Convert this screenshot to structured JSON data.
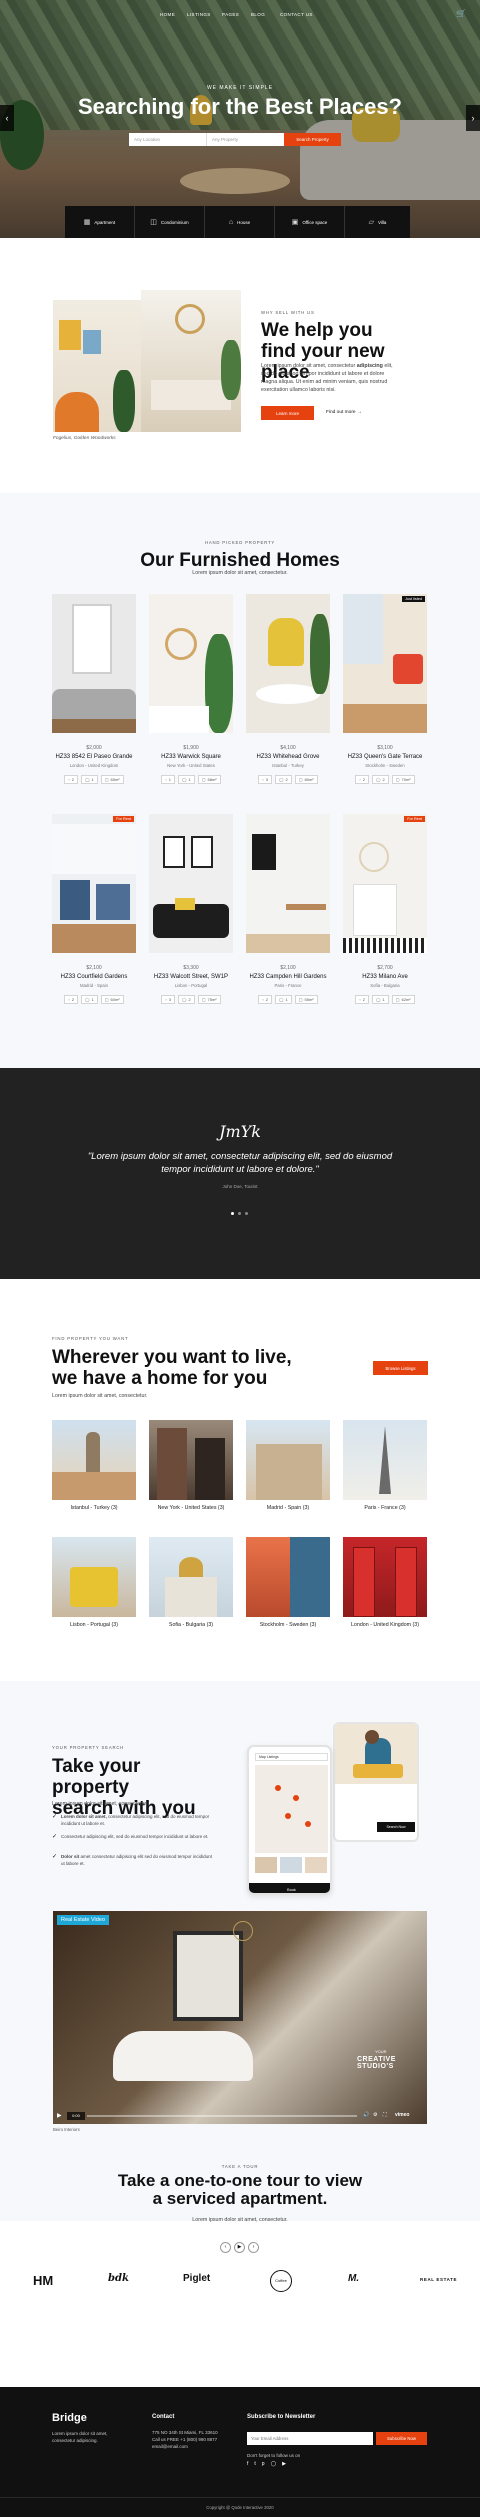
{
  "nav": {
    "items": [
      "HOME",
      "LISTINGS",
      "PAGES",
      "BLOG",
      "CONTACT US"
    ],
    "cart_icon": "cart-icon"
  },
  "hero": {
    "kicker": "WE MAKE IT SIMPLE",
    "title": "Searching for the Best Places?",
    "location_placeholder": "Any Location",
    "type_placeholder": "Any Property",
    "search_label": "Search Property",
    "categories": [
      {
        "label": "Apartment",
        "icon": "building-icon"
      },
      {
        "label": "Condominium",
        "icon": "condo-icon"
      },
      {
        "label": "House",
        "icon": "house-icon"
      },
      {
        "label": "Office space",
        "icon": "office-icon"
      },
      {
        "label": "Villa",
        "icon": "villa-icon"
      }
    ]
  },
  "help": {
    "kicker": "WHY SELL WITH US",
    "title": "We help you find your new place",
    "body_lead": "Lorem ipsum dolor sit amet, consectetur",
    "body_bold": "adipiscing",
    "body_rest": "elit, sed do eiusmod tempor incididunt ut labore et dolore magna aliqua. Ut enim ad minim veniam, quis nostrud exercitation ullamco laboris nisi.",
    "cta": "Learn more",
    "link": "Find out more",
    "caption": "Fogelius, Golden Woodworks"
  },
  "homes": {
    "kicker": "HAND PICKED PROPERTY",
    "title": "Our Furnished Homes",
    "subtitle": "Lorem ipsum dolor sit amet, consectetur.",
    "cards": [
      {
        "price": "$2,000",
        "title": "HZ33 8542 El Paseo Grande",
        "loc": "London - United Kingdom",
        "beds": "2",
        "baths": "1",
        "area": "65m²",
        "badge": ""
      },
      {
        "price": "$1,900",
        "title": "HZ33 Warwick Square",
        "loc": "New York - United States",
        "beds": "1",
        "baths": "1",
        "area": "58m²",
        "badge": ""
      },
      {
        "price": "$4,100",
        "title": "HZ33 Whitehead Grove",
        "loc": "Istanbul - Turkey",
        "beds": "3",
        "baths": "2",
        "area": "80m²",
        "badge": ""
      },
      {
        "price": "$3,100",
        "title": "HZ33 Queen's Gate Terrace",
        "loc": "Stockholm - Sweden",
        "beds": "2",
        "baths": "2",
        "area": "70m²",
        "badge": "Just listed"
      },
      {
        "price": "$2,100",
        "title": "HZ33 Courtfield Gardens",
        "loc": "Madrid - Spain",
        "beds": "2",
        "baths": "1",
        "area": "60m²",
        "badge": "For Rent"
      },
      {
        "price": "$3,300",
        "title": "HZ33 Walcott Street, SW1P",
        "loc": "Lisbon - Portugal",
        "beds": "3",
        "baths": "2",
        "area": "75m²",
        "badge": ""
      },
      {
        "price": "$2,100",
        "title": "HZ33 Campden Hill Gardens",
        "loc": "Paris - France",
        "beds": "2",
        "baths": "1",
        "area": "55m²",
        "badge": ""
      },
      {
        "price": "$2,700",
        "title": "HZ33 Milano Ave",
        "loc": "Sofia - Bulgaria",
        "beds": "2",
        "baths": "1",
        "area": "62m²",
        "badge": "For Rent"
      }
    ]
  },
  "testimonial": {
    "quote": "\"Lorem ipsum dolor sit amet, consectetur adipiscing elit, sed do eiusmod tempor incididunt ut labore et dolore.\"",
    "author": "John Doe, Tourist",
    "signature": "JmYk"
  },
  "cities": {
    "kicker": "FIND PROPERTY YOU WANT",
    "title_line1": "Wherever you want to live,",
    "title_line2": "we have a home for you",
    "subtitle": "Lorem ipsum dolor sit amet, consectetur.",
    "cta": "Browse Listings",
    "items": [
      "Istanbul - Turkey (3)",
      "New York - United States (3)",
      "Madrid - Spain (3)",
      "Paris - France (3)",
      "Lisbon - Portugal (3)",
      "Sofia - Bulgaria (3)",
      "Stockholm - Sweden (3)",
      "London - United Kingdom (3)"
    ]
  },
  "app": {
    "kicker": "YOUR PROPERTY SEARCH",
    "title_line1": "Take your property",
    "title_line2": "search with you",
    "subtitle": "Lorem ipsum dolor sit amet, consectetur.",
    "checks": [
      {
        "lead": "Lorem dolor sit amet,",
        "rest": " consectetur adipiscing elit, sed do eiusmod tempor incididunt ut labore et."
      },
      {
        "lead": "Consectetur",
        "rest": " adipiscing elit, sed do eiusmod tempor incididunt ut labore et."
      },
      {
        "lead": "Dolor sit",
        "rest": " amet consectetur adipiscing elit sed do eiusmod tempor incididunt ut labore et."
      }
    ],
    "phone_map_title": "Map Listings",
    "phone_action": "Book",
    "tablet_action": "Search Now"
  },
  "video": {
    "title": "Real Estate Video",
    "brand_small": "YOUR",
    "brand": "CREATIVE STUDIO'S",
    "time": "0:00",
    "vimeo": "vimeo",
    "caption": "Beiro Interiors"
  },
  "tour": {
    "kicker": "TAKE A TOUR",
    "title_line1": "Take a one-to-one tour to view",
    "title_line2": "a serviced apartment.",
    "subtitle": "Lorem ipsum dolor sit amet, consectetur."
  },
  "logos": [
    "HM",
    "bdk",
    "Piglet",
    "Coffee",
    "M.",
    "REAL ESTATE"
  ],
  "footer": {
    "brand": "Bridge",
    "brand_text": "Lorem ipsum dolor sit amet, consectetur adipiscing.",
    "contact_title": "Contact",
    "contact_lines": [
      "775 NO 34th St Miami, FL 33610",
      "Call us FREE +1 (800) 990 8877",
      "email@email.com"
    ],
    "newsletter_title": "Subscribe to Newsletter",
    "email_placeholder": "Your Email Address",
    "subscribe": "Subscribe Now",
    "follow": "Don't forget to follow us on",
    "copyright": "Copyright @ Qode Interactive 2020"
  },
  "colors": {
    "accent": "#e6420f",
    "dark": "#111111",
    "light_bg": "#f6f8fb"
  }
}
